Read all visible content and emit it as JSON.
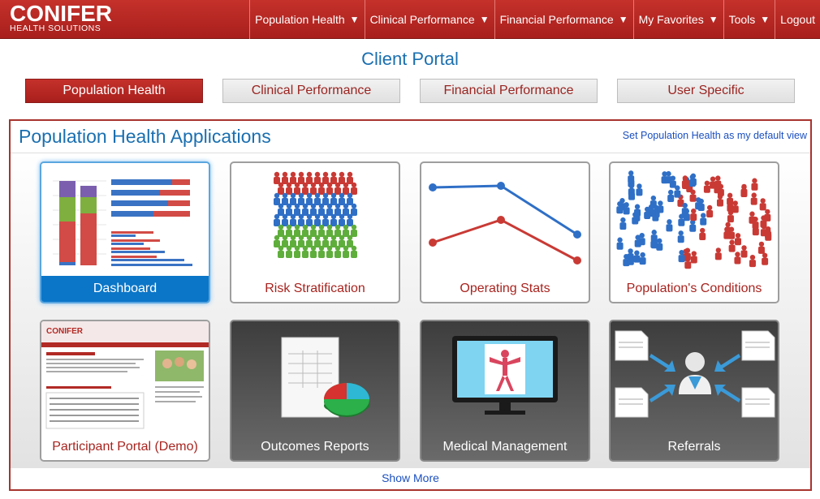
{
  "brand": {
    "name": "CONIFER",
    "subtitle": "HEALTH SOLUTIONS"
  },
  "nav": {
    "items": [
      {
        "label": "Population Health",
        "caret": "▼"
      },
      {
        "label": "Clinical Performance",
        "caret": "▼"
      },
      {
        "label": "Financial Performance",
        "caret": "▼"
      },
      {
        "label": "My Favorites",
        "caret": "▼"
      },
      {
        "label": "Tools",
        "caret": "▼"
      },
      {
        "label": "Logout",
        "caret": ""
      }
    ]
  },
  "portal_title": "Client Portal",
  "tabs": [
    {
      "label": "Population Health",
      "active": true
    },
    {
      "label": "Clinical Performance",
      "active": false
    },
    {
      "label": "Financial Performance",
      "active": false
    },
    {
      "label": "User Specific",
      "active": false
    }
  ],
  "panel": {
    "title": "Population Health Applications",
    "default_link": "Set Population Health as my default view",
    "show_more": "Show More"
  },
  "cards": [
    {
      "label": "Dashboard",
      "icon": "dashboard-chart-icon"
    },
    {
      "label": "Risk Stratification",
      "icon": "people-crowd-icon"
    },
    {
      "label": "Operating Stats",
      "icon": "line-chart-icon"
    },
    {
      "label": "Population's Conditions",
      "icon": "scattered-people-icon"
    },
    {
      "label": "Participant Portal (Demo)",
      "icon": "portal-screenshot-icon"
    },
    {
      "label": "Outcomes Reports",
      "icon": "report-pie-icon"
    },
    {
      "label": "Medical Management",
      "icon": "monitor-body-icon"
    },
    {
      "label": "Referrals",
      "icon": "doctor-referral-icon"
    }
  ],
  "colors": {
    "brand_red": "#b22a25",
    "link_blue": "#1b4fbf",
    "title_blue": "#1a6fb0",
    "selected_blue": "#0b76c8"
  }
}
